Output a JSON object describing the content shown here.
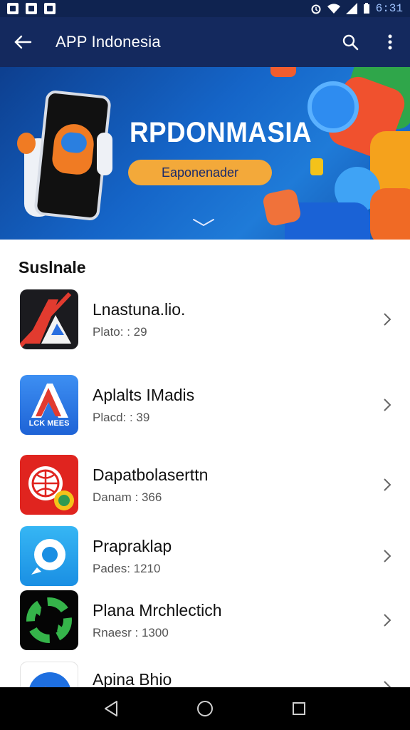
{
  "status_bar": {
    "time": "6:31"
  },
  "app_bar": {
    "title": "APP Indonesia",
    "back_icon": "arrow-back-icon",
    "search_icon": "search-icon",
    "menu_icon": "more-vert-icon"
  },
  "banner": {
    "title": "RPDONMASIA",
    "button_label": "Eaponenader"
  },
  "section": {
    "title": "Suslnale"
  },
  "apps": [
    {
      "name": "Lnastuna.lio.",
      "meta": "Plato: : 29"
    },
    {
      "name": "Aplalts IMadis",
      "meta": "Placd: : 39",
      "icon_caption": "LCK MEES"
    },
    {
      "name": "Dapatbolaserttn",
      "meta": "Danam : 366"
    },
    {
      "name": "Prapraklap",
      "meta": "Pades: 1210"
    },
    {
      "name": "Plana Mrchlectich",
      "meta": "Rnaesr : 1300"
    },
    {
      "name": "Apina Bhio",
      "meta": ""
    }
  ]
}
